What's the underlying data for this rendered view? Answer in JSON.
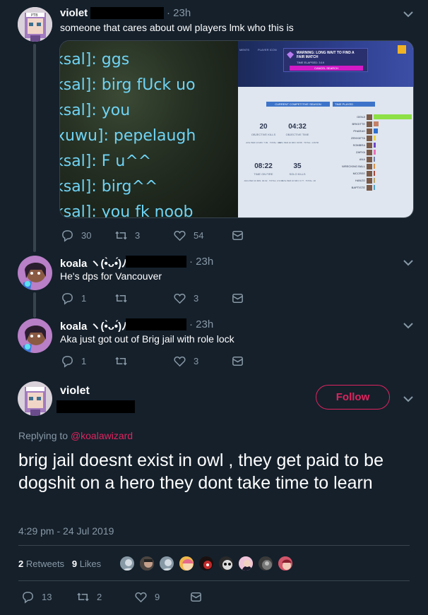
{
  "tweets": [
    {
      "author": "violet",
      "time": "23h",
      "text": "someone that cares about owl players lmk who this is",
      "replies": "30",
      "retweets": "3",
      "likes": "54",
      "media": {
        "chat_lines": [
          "ksal]: ggs",
          "ksal]: birg fUck uo",
          "ksal]: you",
          "xuwu]: pepelaugh",
          "ksal]: F u^^",
          "ksal]: birg^^",
          "ksal]: you fk noob"
        ],
        "game": {
          "top_tabs": [
            "MENTS",
            "PLAYER ICON"
          ],
          "warning": "WARNING: LONG WAIT TO FIND A FAIR MATCH",
          "time_elapsed": "TIME ELAPSED: 3:19",
          "cancel": "CANCEL SEARCH",
          "season_dropdown": "CURRENT COMPETITIVE SEASON",
          "sort_dropdown": "TIME PLAYED",
          "stats": [
            {
              "value": "20",
              "label": "OBJECTIVE KILLS",
              "sub": "AVG PER 10 MIN: 7.99 · TOTAL: 404"
            },
            {
              "value": "04:32",
              "label": "OBJECTIVE TIME",
              "sub": "AVG PER 10 MIN: 00:58 · TOTAL: 1:49:50"
            },
            {
              "value": "08:22",
              "label": "TIME ON FIRE",
              "sub": "AVG PER 10 MIN: 02:02 · TOTAL: 2:3:05"
            },
            {
              "value": "35",
              "label": "SOLO KILLS",
              "sub": "AVG PER 10 MIN: 0.77 · TOTAL: 46"
            }
          ],
          "heroes": [
            {
              "name": "GENJI",
              "pct": 0.96,
              "color": "#8de045"
            },
            {
              "name": "BRIGITTE",
              "pct": 0.13,
              "color": "#c48068"
            },
            {
              "name": "PHARAH",
              "pct": 0.1,
              "color": "#2f6fd0"
            },
            {
              "name": "ZENYATTA",
              "pct": 0.06,
              "color": "#e8d34c"
            },
            {
              "name": "SOMBRA",
              "pct": 0.05,
              "color": "#6d47c5"
            },
            {
              "name": "ZARYA",
              "pct": 0.05,
              "color": "#e86fb5"
            },
            {
              "name": "ANA",
              "pct": 0.04,
              "color": "#6f7fa6"
            },
            {
              "name": "WRECKING BALL",
              "pct": 0.04,
              "color": "#d8914a"
            },
            {
              "name": "MCCREE",
              "pct": 0.03,
              "color": "#a8473a"
            },
            {
              "name": "HANZO",
              "pct": 0.03,
              "color": "#b8a46a"
            },
            {
              "name": "BAPTISTE",
              "pct": 0.02,
              "color": "#4fa3c8"
            }
          ]
        }
      }
    },
    {
      "author": "koala ヽ(•̀ᴗ•́)ﾉ",
      "time": "23h",
      "text": "He's dps for Vancouver",
      "replies": "1",
      "retweets": "",
      "likes": "3"
    },
    {
      "author": "koala ヽ(•̀ᴗ•́)ﾉ",
      "time": "23h",
      "text": "Aka just got out of Brig jail with role lock",
      "replies": "1",
      "retweets": "",
      "likes": "3"
    }
  ],
  "main_tweet": {
    "author": "violet",
    "follow_label": "Follow",
    "replying_prefix": "Replying to",
    "replying_handle": "@koalawizard",
    "text": "brig jail doesnt exist in owl , they get paid to be dogshit on a hero they dont take time to learn",
    "timestamp": "4:29 pm - 24 Jul 2019",
    "retweets_count": "2",
    "retweets_label": "Retweets",
    "likes_count": "9",
    "likes_label": "Likes",
    "replies": "13",
    "retweets": "2",
    "likes": "9"
  },
  "colors": {
    "background": "#15202b",
    "secondary_text": "#8899a6",
    "link": "#e0245e",
    "divider": "#38444d"
  }
}
